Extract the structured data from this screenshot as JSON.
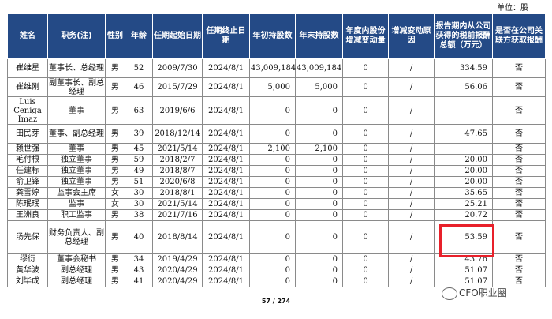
{
  "unit_label": "单位：股",
  "headers": [
    "姓名",
    "职务(注)",
    "性别",
    "年龄",
    "任期起始日期",
    "任期终止日期",
    "年初持股数",
    "年末持股数",
    "年度内股份增减变动量",
    "增减变动原因",
    "报告期内从公司获得的税前报酬总额（万元）",
    "是否在公司关联方获取报酬"
  ],
  "rows": [
    [
      "崔维星",
      "董事长、总经理",
      "男",
      "52",
      "2009/7/30",
      "2024/8/1",
      "43,009,184",
      "43,009,184",
      "0",
      "/",
      "334.59",
      "否"
    ],
    [
      "崔维刚",
      "副董事长、副总经理",
      "男",
      "46",
      "2015/7/29",
      "2024/8/1",
      "5,000",
      "5,000",
      "0",
      "/",
      "56.06",
      "否"
    ],
    [
      "Luis Ceniga Imaz",
      "董事",
      "男",
      "63",
      "2019/6/6",
      "2024/8/1",
      "0",
      "0",
      "0",
      "/",
      "",
      "否"
    ],
    [
      "田民芽",
      "董事、副总经理",
      "男",
      "39",
      "2018/12/14",
      "2024/8/1",
      "0",
      "0",
      "0",
      "/",
      "47.65",
      "否"
    ],
    [
      "赖世强",
      "董事",
      "男",
      "45",
      "2021/5/14",
      "2024/8/1",
      "2,100",
      "2,100",
      "0",
      "/",
      "",
      "否"
    ],
    [
      "毛付根",
      "独立董事",
      "男",
      "59",
      "2018/2/7",
      "2024/8/1",
      "0",
      "0",
      "0",
      "/",
      "20.00",
      "否"
    ],
    [
      "任建标",
      "独立董事",
      "男",
      "49",
      "2018/8/7",
      "2024/8/1",
      "0",
      "0",
      "0",
      "/",
      "20.00",
      "否"
    ],
    [
      "俞卫锋",
      "独立董事",
      "男",
      "51",
      "2020/6/8",
      "2024/8/1",
      "0",
      "0",
      "0",
      "/",
      "20.00",
      "否"
    ],
    [
      "龚雪婷",
      "监事会主席",
      "女",
      "30",
      "2018/8/1",
      "2024/8/1",
      "0",
      "0",
      "0",
      "/",
      "35.65",
      "否"
    ],
    [
      "陈珉珉",
      "监事",
      "女",
      "30",
      "2021/5/14",
      "2024/8/1",
      "0",
      "0",
      "0",
      "/",
      "25.21",
      "否"
    ],
    [
      "王洲良",
      "职工监事",
      "男",
      "38",
      "2021/7/16",
      "2024/8/1",
      "0",
      "0",
      "0",
      "/",
      "20.72",
      "否"
    ],
    [
      "汤先保",
      "财务负责人、副总经理",
      "男",
      "40",
      "2018/8/14",
      "2024/8/1",
      "0",
      "0",
      "0",
      "/",
      "53.59",
      "否"
    ],
    [
      "缪衍",
      "董事会秘书",
      "男",
      "34",
      "2019/4/29",
      "2024/8/1",
      "0",
      "0",
      "0",
      "/",
      "43.76",
      "否"
    ],
    [
      "黄华波",
      "副总经理",
      "男",
      "43",
      "2020/4/29",
      "2024/8/1",
      "0",
      "0",
      "0",
      "/",
      "51.07",
      "否"
    ],
    [
      "刘毕成",
      "副总经理",
      "男",
      "41",
      "2020/4/29",
      "2024/8/1",
      "0",
      "0",
      "0",
      "/",
      "51.07",
      "否"
    ]
  ],
  "page_number": "57 / 274",
  "watermark": "CFO职业圈"
}
